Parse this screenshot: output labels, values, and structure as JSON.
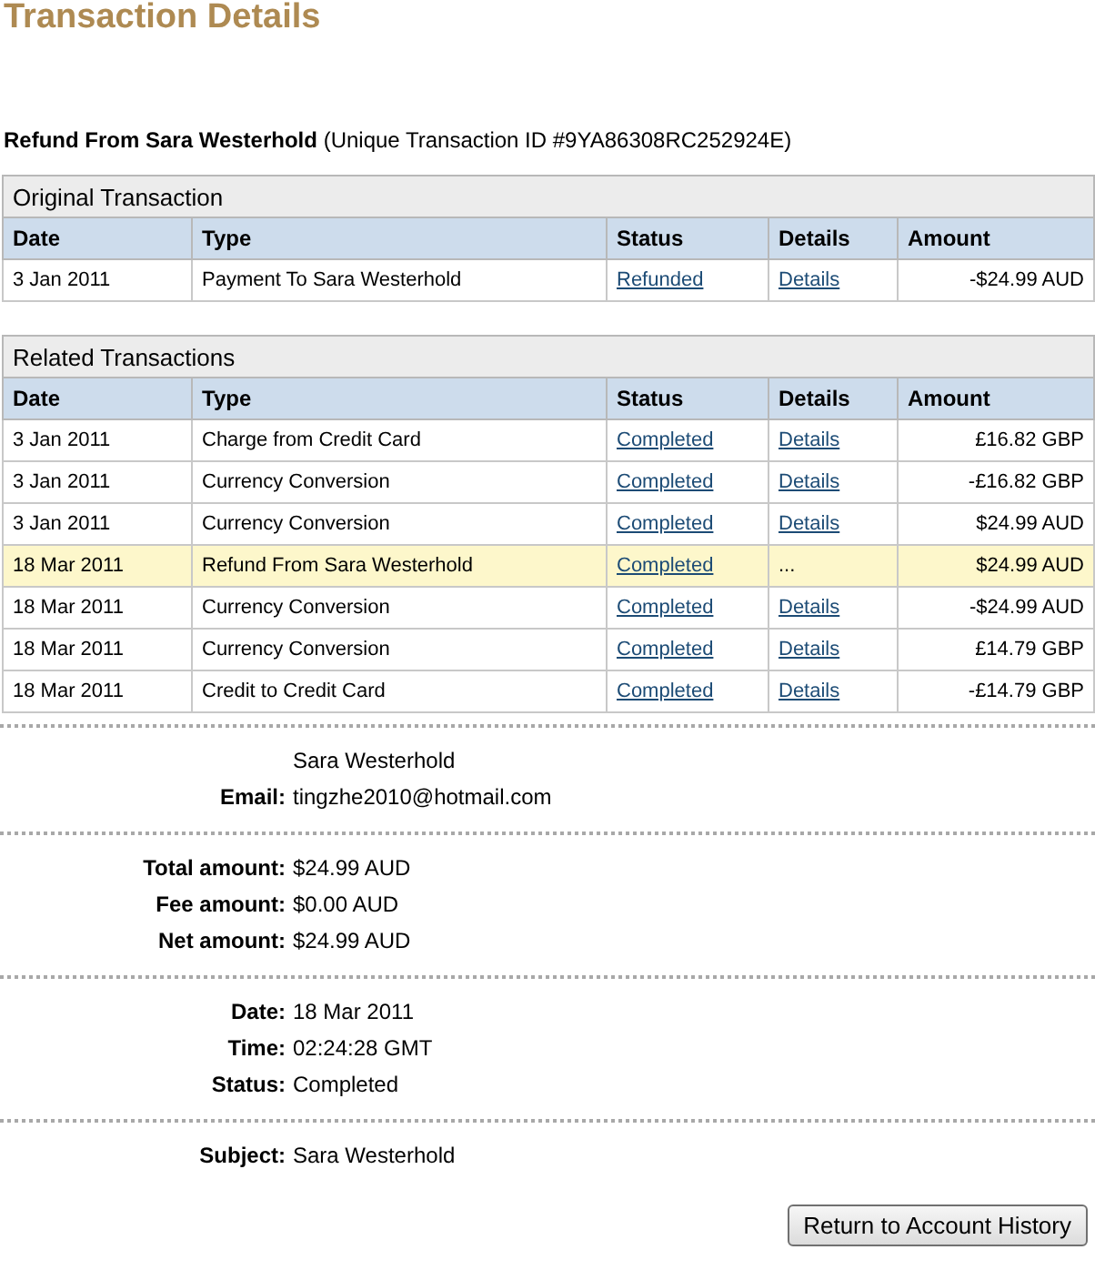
{
  "title": "Transaction Details",
  "summary": {
    "name": "Refund From Sara Westerhold",
    "text": "(Unique Transaction ID #9YA86308RC252924E)"
  },
  "original_transaction": {
    "title": "Original Transaction",
    "columns": [
      "Date",
      "Type",
      "Status",
      "Details",
      "Amount"
    ],
    "rows": [
      {
        "date": "3 Jan 2011",
        "type": "Payment To Sara Westerhold",
        "status": "Refunded",
        "details": "Details",
        "amount": "-$24.99 AUD",
        "selected": false
      }
    ]
  },
  "related_transactions": {
    "title": "Related Transactions",
    "columns": [
      "Date",
      "Type",
      "Status",
      "Details",
      "Amount"
    ],
    "rows": [
      {
        "date": "3 Jan 2011",
        "type": "Charge from Credit Card",
        "status": "Completed",
        "details": "Details",
        "amount": "£16.82 GBP",
        "selected": false
      },
      {
        "date": "3 Jan 2011",
        "type": "Currency Conversion",
        "status": "Completed",
        "details": "Details",
        "amount": "-£16.82 GBP",
        "selected": false
      },
      {
        "date": "3 Jan 2011",
        "type": "Currency Conversion",
        "status": "Completed",
        "details": "Details",
        "amount": "$24.99 AUD",
        "selected": false
      },
      {
        "date": "18 Mar 2011",
        "type": "Refund From Sara Westerhold",
        "status": "Completed",
        "details": "...",
        "amount": "$24.99 AUD",
        "selected": true
      },
      {
        "date": "18 Mar 2011",
        "type": "Currency Conversion",
        "status": "Completed",
        "details": "Details",
        "amount": "-$24.99 AUD",
        "selected": false
      },
      {
        "date": "18 Mar 2011",
        "type": "Currency Conversion",
        "status": "Completed",
        "details": "Details",
        "amount": "£14.79 GBP",
        "selected": false
      },
      {
        "date": "18 Mar 2011",
        "type": "Credit to Credit Card",
        "status": "Completed",
        "details": "Details",
        "amount": "-£14.79 GBP",
        "selected": false
      }
    ]
  },
  "sections": [
    {
      "rows": [
        {
          "value": "Sara Westerhold"
        },
        {
          "label": "Email:",
          "value": "tingzhe2010@hotmail.com"
        }
      ]
    },
    {
      "rows": [
        {
          "label": "Total amount:",
          "value": "$24.99 AUD"
        },
        {
          "label": "Fee amount:",
          "value": "$0.00 AUD"
        },
        {
          "label": "Net amount:",
          "value": "$24.99 AUD"
        }
      ]
    },
    {
      "rows": [
        {
          "label": "Date:",
          "value": "18 Mar 2011"
        },
        {
          "label": "Time:",
          "value": "02:24:28 GMT"
        },
        {
          "label": "Status:",
          "value": "Completed"
        }
      ]
    },
    {
      "rows": [
        {
          "label": "Subject:",
          "value": "Sara Westerhold"
        }
      ]
    }
  ],
  "button": "Return to Account History"
}
